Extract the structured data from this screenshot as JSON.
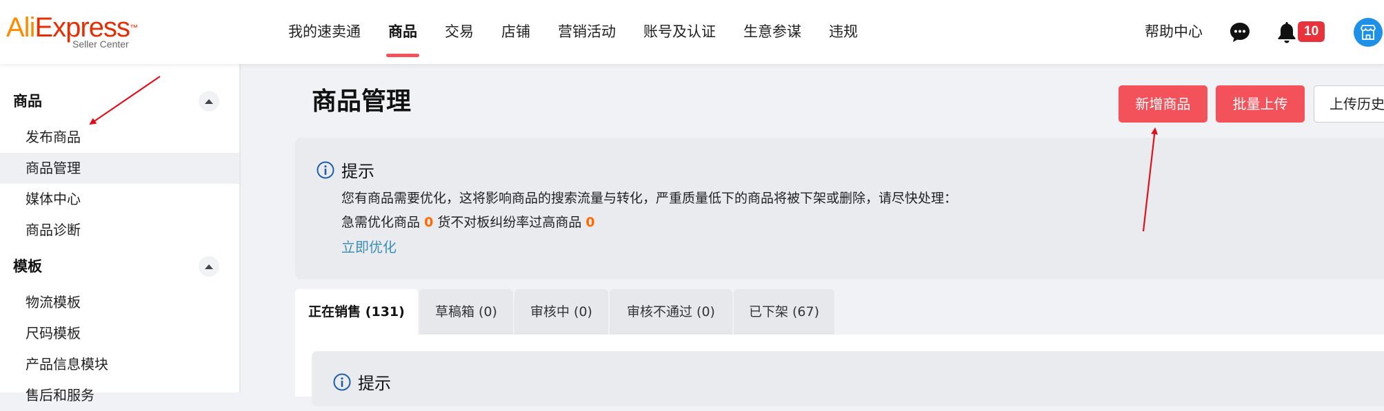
{
  "logo": {
    "part1": "Ali",
    "part2": "Express",
    "sub": "Seller Center",
    "trademark": "™"
  },
  "nav": {
    "items": [
      "我的速卖通",
      "商品",
      "交易",
      "店铺",
      "营销活动",
      "账号及认证",
      "生意参谋",
      "违规"
    ],
    "active_index": 1,
    "help": "帮助中心",
    "badge": "10"
  },
  "sidebar": {
    "group1": {
      "title": "商品",
      "items": [
        "发布商品",
        "商品管理",
        "媒体中心",
        "商品诊断"
      ],
      "active_index": 1
    },
    "group2": {
      "title": "模板",
      "items": [
        "物流模板",
        "尺码模板",
        "产品信息模块",
        "售后和服务"
      ]
    }
  },
  "main": {
    "title": "商品管理",
    "buttons": {
      "add": "新增商品",
      "batch": "批量上传",
      "history": "上传历史"
    },
    "tip": {
      "title": "提示",
      "line1": "您有商品需要优化，这将影响商品的搜索流量与转化，严重质量低下的商品将被下架或删除，请尽快处理：",
      "urgent_label": "急需优化商品",
      "urgent_count": "0",
      "mismatch_label": "货不对板纠纷率过高商品",
      "mismatch_count": "0",
      "link": "立即优化"
    },
    "tabs": [
      "正在销售 (131)",
      "草稿箱 (0)",
      "审核中 (0)",
      "审核不通过 (0)",
      "已下架 (67)"
    ],
    "active_tab": 0,
    "inner_tip_title": "提示"
  },
  "colors": {
    "accent_red": "#f4525b",
    "brand_orange": "#ff8a00",
    "brand_red": "#e62e04",
    "link": "#3c8fb5",
    "count_orange": "#ff6a00",
    "annotation_arrow": "#e0101b"
  }
}
